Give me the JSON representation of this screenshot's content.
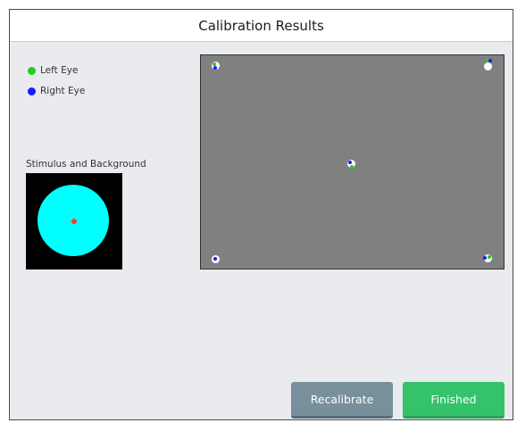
{
  "window": {
    "title": "Calibration Results"
  },
  "legend": [
    {
      "label": "Left Eye",
      "color": "#1fd01f"
    },
    {
      "label": "Right Eye",
      "color": "#1a1aff"
    }
  ],
  "stimulus": {
    "label": "Stimulus and Background",
    "background_color": "#000000",
    "circle_color": "#00ffff",
    "fixation_color": "#ff3b1a"
  },
  "plot": {
    "background_color": "#808080",
    "target_color": "#ffffff",
    "points": [
      {
        "name": "top-left"
      },
      {
        "name": "top-right"
      },
      {
        "name": "center"
      },
      {
        "name": "bottom-left"
      },
      {
        "name": "bottom-right"
      }
    ]
  },
  "buttons": {
    "recalibrate": {
      "label": "Recalibrate",
      "color": "#78909c"
    },
    "finished": {
      "label": "Finished",
      "color": "#34c26b"
    }
  }
}
